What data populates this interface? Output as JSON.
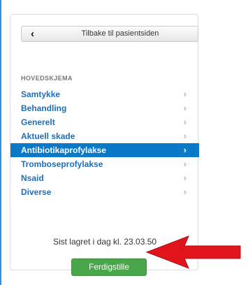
{
  "back_button": {
    "label": "Tilbake til pasientsiden",
    "icon": "chevron-left-icon"
  },
  "section": {
    "header": "HOVEDSKJEMA"
  },
  "nav": {
    "items": [
      {
        "label": "Samtykke",
        "active": false
      },
      {
        "label": "Behandling",
        "active": false
      },
      {
        "label": "Generelt",
        "active": false
      },
      {
        "label": "Aktuell skade",
        "active": false
      },
      {
        "label": "Antibiotikaprofylakse",
        "active": true
      },
      {
        "label": "Tromboseprofylakse",
        "active": false
      },
      {
        "label": "Nsaid",
        "active": false
      },
      {
        "label": "Diverse",
        "active": false
      }
    ],
    "arrow_glyph": "›"
  },
  "status": {
    "saved_text": "Sist lagret i dag kl. 23.03.50"
  },
  "finish_button": {
    "label": "Ferdigstille"
  },
  "colors": {
    "active_bg": "#0a79c7",
    "link": "#1a6fc0",
    "finish_green": "#4aa64a",
    "annotation_red": "#e0141a"
  }
}
